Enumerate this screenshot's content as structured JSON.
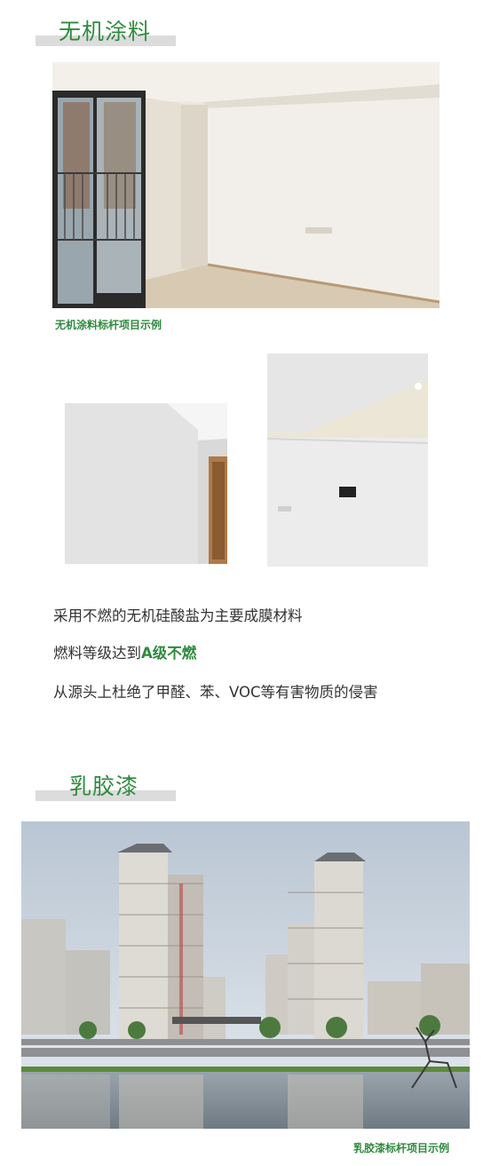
{
  "section1": {
    "title": "无机涂料",
    "caption": "无机涂料标杆项目示例",
    "features": {
      "line1": "采用不燃的无机硅酸盐为主要成膜材料",
      "line2_prefix": "燃料等级达到",
      "line2_highlight": "A级不燃",
      "line3": "从源头上杜绝了甲醛、苯、VOC等有害物质的侵害"
    }
  },
  "section2": {
    "title": "乳胶漆",
    "caption": "乳胶漆标杆项目示例"
  },
  "colors": {
    "accent_green": "#2f8a3e",
    "heading_bar": "#dcdcdc",
    "body_text": "#333333"
  }
}
